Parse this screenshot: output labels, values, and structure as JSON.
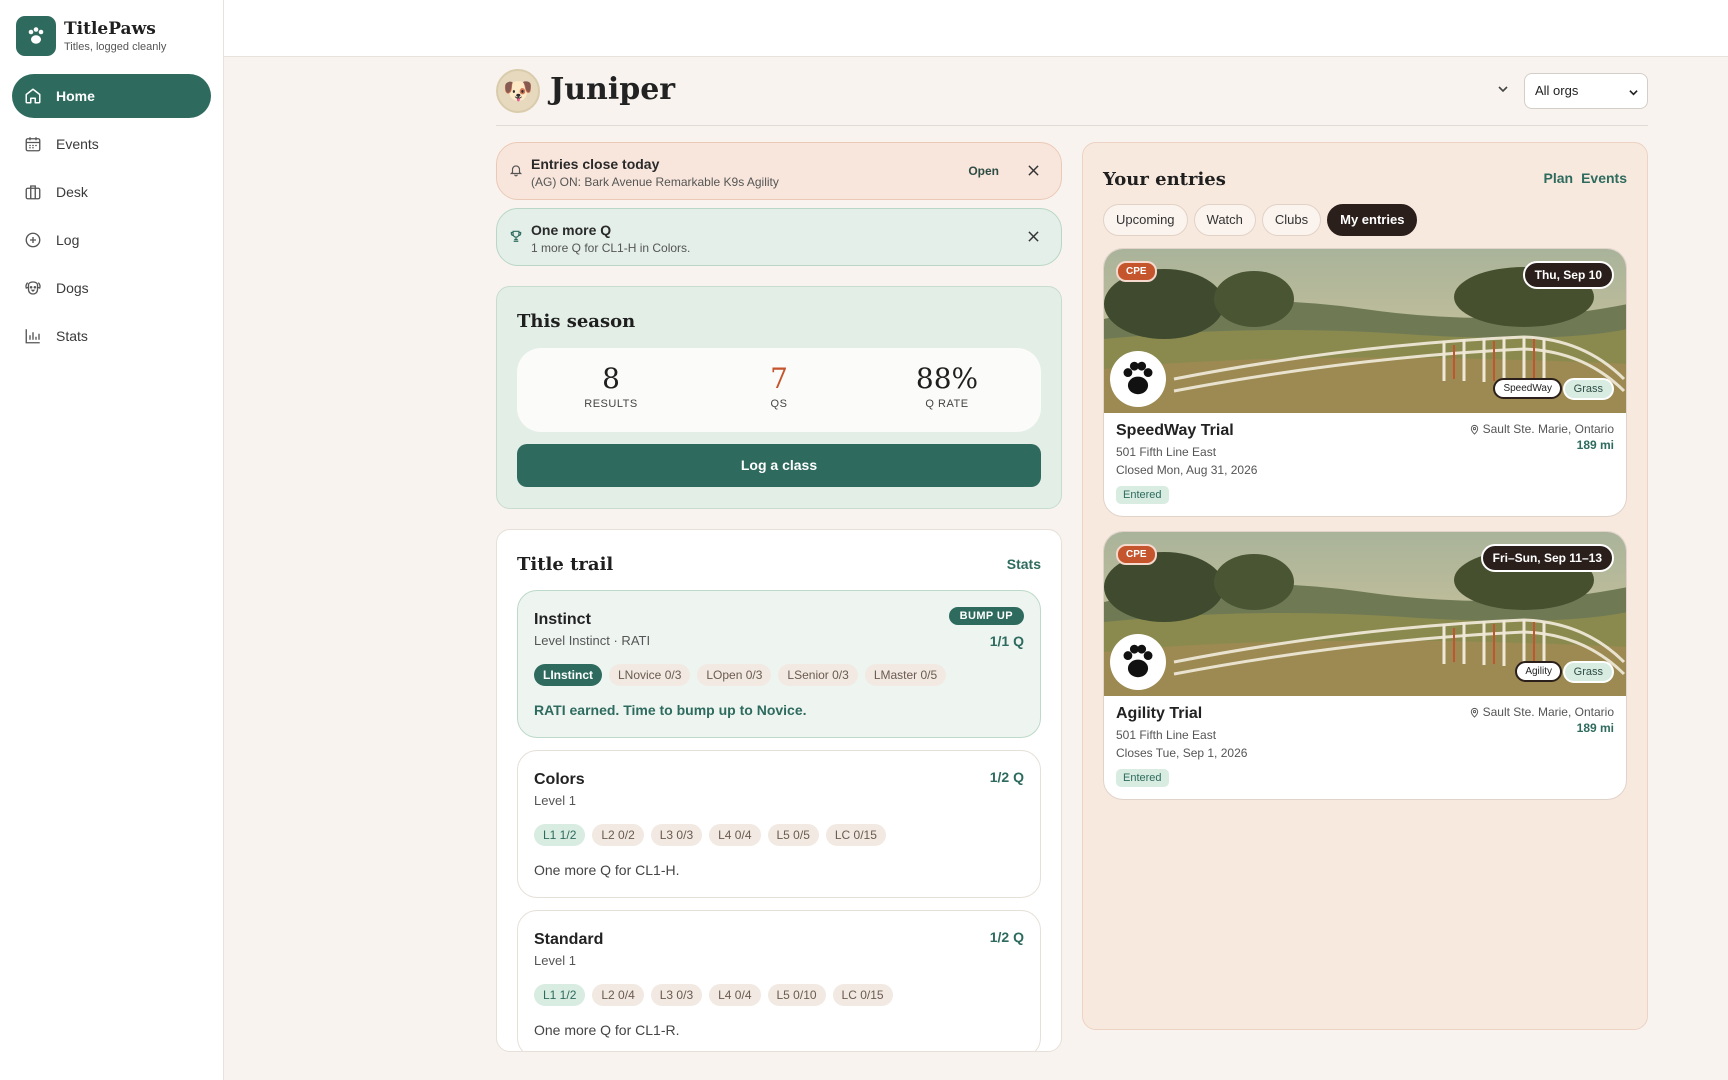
{
  "brand": {
    "name": "TitlePaws",
    "tagline": "Titles, logged cleanly"
  },
  "nav": [
    {
      "label": "Home",
      "icon": "home-icon",
      "active": true
    },
    {
      "label": "Events",
      "icon": "calendar-icon"
    },
    {
      "label": "Desk",
      "icon": "briefcase-icon"
    },
    {
      "label": "Log",
      "icon": "plus-circle-icon"
    },
    {
      "label": "Dogs",
      "icon": "dog-icon"
    },
    {
      "label": "Stats",
      "icon": "bar-chart-icon"
    }
  ],
  "dog": {
    "name": "Juniper",
    "avatar": "🐶"
  },
  "org_select": {
    "value": "All orgs"
  },
  "alerts": [
    {
      "title": "Entries close today",
      "subtitle": "(AG) ON: Bark Avenue Remarkable K9s Agility",
      "action": "Open",
      "icon": "bell-icon"
    },
    {
      "title": "One more Q",
      "subtitle": "1 more Q for CL1-H in Colors.",
      "icon": "trophy-icon"
    }
  ],
  "season": {
    "title": "This season",
    "results": {
      "value": "8",
      "label": "RESULTS"
    },
    "qs": {
      "value": "7",
      "label": "QS"
    },
    "qrate": {
      "value": "88%",
      "label": "Q RATE"
    },
    "log_button": "Log a class"
  },
  "trail": {
    "title": "Title trail",
    "stats_link": "Stats",
    "items": [
      {
        "name": "Instinct",
        "sub": "Level Instinct · RATI",
        "badge": "BUMP UP",
        "q": "1/1 Q",
        "chips": [
          "LInstinct",
          "LNovice 0/3",
          "LOpen 0/3",
          "LSenior 0/3",
          "LMaster 0/5"
        ],
        "message": "RATI earned. Time to bump up to Novice."
      },
      {
        "name": "Colors",
        "sub": "Level 1",
        "q": "1/2 Q",
        "chips": [
          "L1 1/2",
          "L2 0/2",
          "L3 0/3",
          "L4 0/4",
          "L5 0/5",
          "LC 0/15"
        ],
        "message": "One more Q for CL1-H."
      },
      {
        "name": "Standard",
        "sub": "Level 1",
        "q": "1/2 Q",
        "chips": [
          "L1 1/2",
          "L2 0/4",
          "L3 0/3",
          "L4 0/4",
          "L5 0/10",
          "LC 0/15"
        ],
        "message": "One more Q for CL1-R."
      }
    ]
  },
  "entries": {
    "title": "Your entries",
    "links": [
      "Plan",
      "Events"
    ],
    "tabs": [
      "Upcoming",
      "Watch",
      "Clubs",
      "My entries"
    ],
    "active_tab": "My entries",
    "items": [
      {
        "org": "CPE",
        "date": "Thu, Sep 10",
        "sport": "SpeedWay",
        "surface": "Grass",
        "name": "SpeedWay Trial",
        "address": "501 Fifth Line East",
        "closes": "Closed Mon, Aug 31, 2026",
        "status": "Entered",
        "location": "Sault Ste. Marie, Ontario",
        "distance": "189 mi"
      },
      {
        "org": "CPE",
        "date": "Fri–Sun, Sep 11–13",
        "sport": "Agility",
        "surface": "Grass",
        "name": "Agility Trial",
        "address": "501 Fifth Line East",
        "closes": "Closes Tue, Sep 1, 2026",
        "status": "Entered",
        "location": "Sault Ste. Marie, Ontario",
        "distance": "189 mi"
      }
    ]
  },
  "colors": {
    "accent": "#2e6b5e",
    "orange": "#c4552d",
    "dark": "#2b1f1b"
  }
}
